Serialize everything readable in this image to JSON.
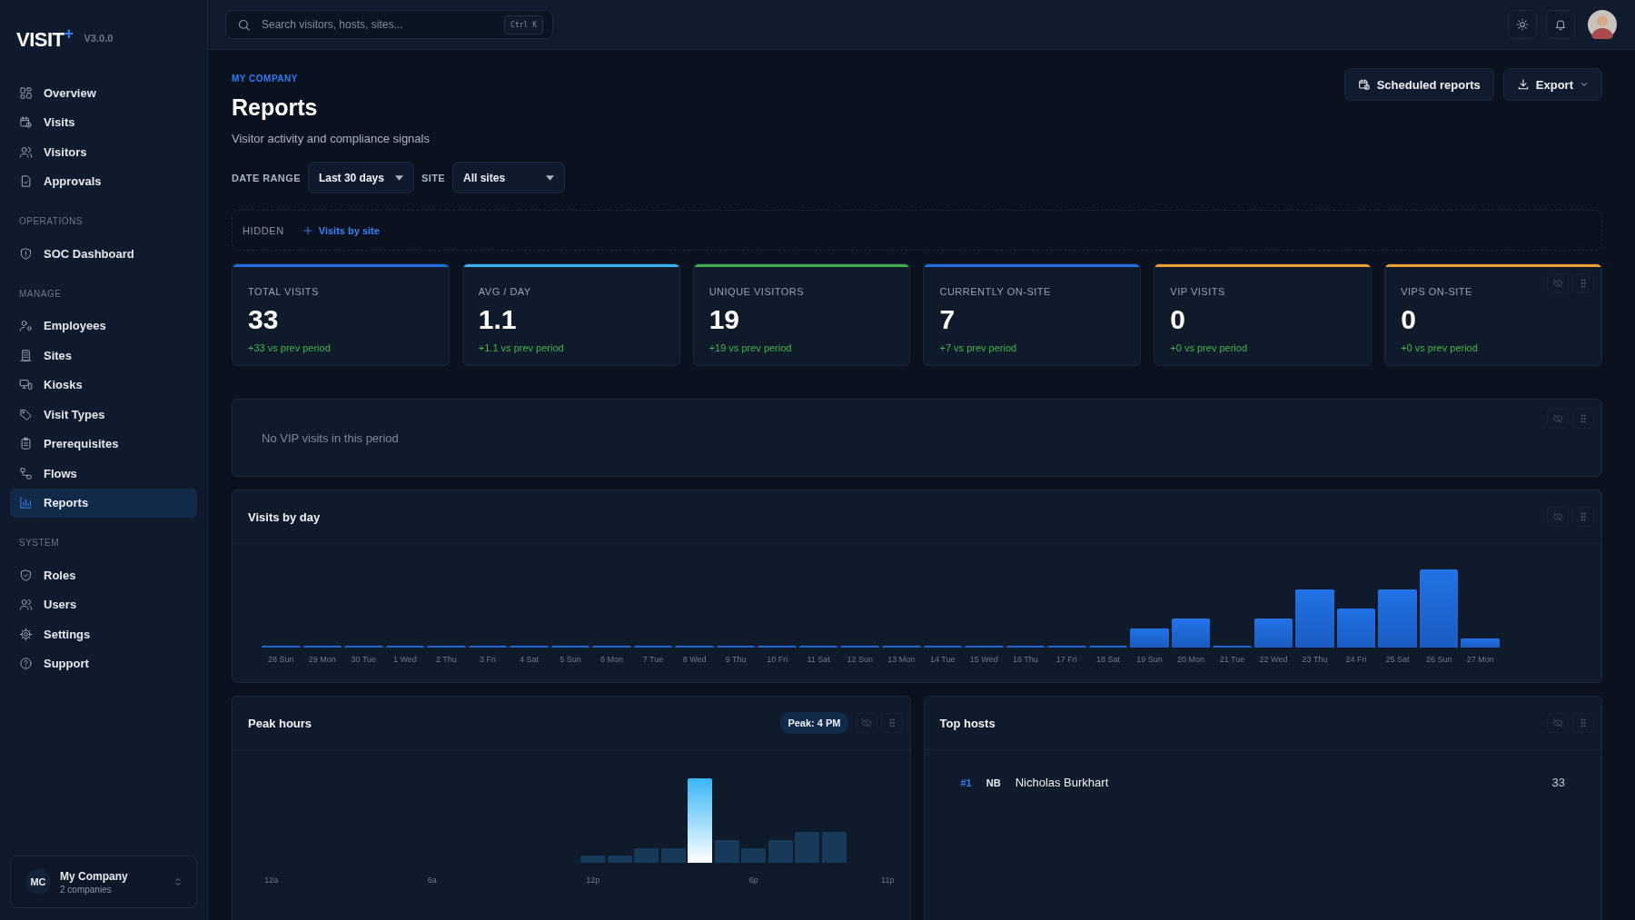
{
  "sidebar": {
    "logo": "VISIT",
    "logo_mark": "+",
    "version": "V3.0.0",
    "sections": [
      {
        "items": [
          {
            "label": "Overview",
            "selected": false
          },
          {
            "label": "Visits",
            "selected": false
          },
          {
            "label": "Visitors",
            "selected": false
          },
          {
            "label": "Approvals",
            "selected": false
          }
        ]
      },
      {
        "heading": "OPERATIONS",
        "items": [
          {
            "label": "SOC Dashboard",
            "selected": false
          }
        ]
      },
      {
        "heading": "MANAGE",
        "items": [
          {
            "label": "Employees",
            "selected": false
          },
          {
            "label": "Sites",
            "selected": false
          },
          {
            "label": "Kiosks",
            "selected": false
          },
          {
            "label": "Visit Types",
            "selected": false
          },
          {
            "label": "Prerequisites",
            "selected": false
          },
          {
            "label": "Flows",
            "selected": false
          },
          {
            "label": "Reports",
            "selected": true
          }
        ]
      },
      {
        "heading": "SYSTEM",
        "items": [
          {
            "label": "Roles",
            "selected": false
          },
          {
            "label": "Users",
            "selected": false
          },
          {
            "label": "Settings",
            "selected": false
          },
          {
            "label": "Support",
            "selected": false
          }
        ]
      }
    ],
    "company": {
      "initials": "MC",
      "name": "My Company",
      "sub": "2 companies"
    }
  },
  "topbar": {
    "search": {
      "placeholder": "Search visitors, hosts, sites..."
    },
    "shortcut": "Ctrl K"
  },
  "page": {
    "breadcrumb": "MY COMPANY",
    "title": "Reports",
    "subtitle": "Visitor activity and compliance signals",
    "actions": [
      "Scheduled reports",
      "Export"
    ]
  },
  "filters": [
    {
      "label": "DATE RANGE",
      "value": "Last 30 days"
    },
    {
      "label": "SITE",
      "value": "All sites"
    }
  ],
  "hidden": {
    "label": "HIDDEN",
    "items": [
      "Visits by site"
    ]
  },
  "stats": [
    {
      "label": "TOTAL VISITS",
      "value": "33",
      "delta": "+33 vs prev period",
      "color": "#1f6fe0"
    },
    {
      "label": "AVG / DAY",
      "value": "1.1",
      "delta": "+1.1 vs prev period",
      "color": "#38b2f0"
    },
    {
      "label": "UNIQUE VISITORS",
      "value": "19",
      "delta": "+19 vs prev period",
      "color": "#3fae4c"
    },
    {
      "label": "CURRENTLY ON-SITE",
      "value": "7",
      "delta": "+7 vs prev period",
      "color": "#1f6fe0"
    },
    {
      "label": "VIP VISITS",
      "value": "0",
      "delta": "+0 vs prev period",
      "color": "#f0a030"
    },
    {
      "label": "VIPS ON-SITE",
      "value": "0",
      "delta": "+0 vs prev period",
      "color": "#f0a030",
      "controls": true
    }
  ],
  "vip_panel": {
    "empty": "No VIP visits in this period"
  },
  "visits_by_day": {
    "title": "Visits by day",
    "day_labels": [
      "28 Sun",
      "29 Mon",
      "30 Tue",
      "1 Wed",
      "2 Thu",
      "3 Fri",
      "4 Sat",
      "5 Sun",
      "6 Mon",
      "7 Tue",
      "8 Wed",
      "9 Thu",
      "10 Fri",
      "11 Sat",
      "12 Sun",
      "13 Mon",
      "14 Tue",
      "15 Wed",
      "16 Thu",
      "17 Fri",
      "18 Sat",
      "19 Sun",
      "20 Mon",
      "21 Tue",
      "22 Wed",
      "23 Thu",
      "24 Fri",
      "25 Sat",
      "26 Sun",
      "27 Mon"
    ]
  },
  "peak_hours": {
    "title": "Peak hours",
    "badge": "Peak: 4 PM",
    "hour_labels": [
      "12a",
      "6a",
      "12p",
      "6p",
      "11p"
    ]
  },
  "top_hosts": {
    "title": "Top hosts",
    "rows": [
      {
        "rank": "#1",
        "initials": "NB",
        "name": "Nicholas Burkhart",
        "count": "33"
      }
    ]
  }
}
